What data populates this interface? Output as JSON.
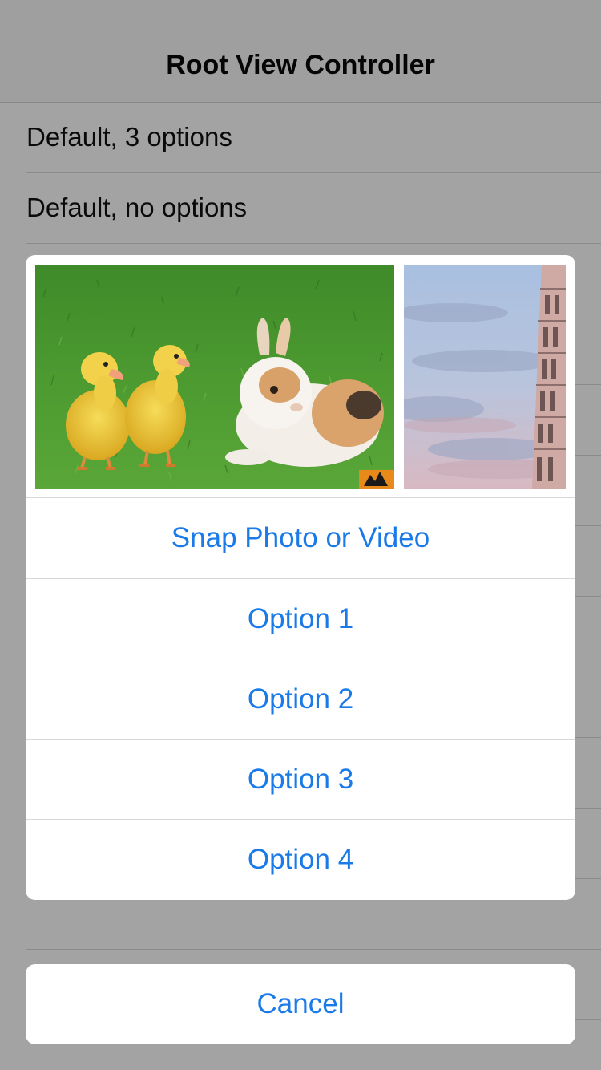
{
  "navbar": {
    "title": "Root View Controller"
  },
  "table": {
    "rows": [
      {
        "label": "Default, 3 options"
      },
      {
        "label": "Default, no options"
      }
    ]
  },
  "action_sheet": {
    "photos": [
      {
        "icon": "ducklings-and-rabbit-photo"
      },
      {
        "icon": "leaning-tower-photo"
      }
    ],
    "buttons": [
      {
        "label": "Snap Photo or Video"
      },
      {
        "label": "Option 1"
      },
      {
        "label": "Option 2"
      },
      {
        "label": "Option 3"
      },
      {
        "label": "Option 4"
      }
    ],
    "cancel_label": "Cancel"
  },
  "colors": {
    "dim_background": "#a3a3a3",
    "tint": "#1a7ae8",
    "sheet_background": "#ffffff",
    "separator": "#d8d8d8"
  }
}
